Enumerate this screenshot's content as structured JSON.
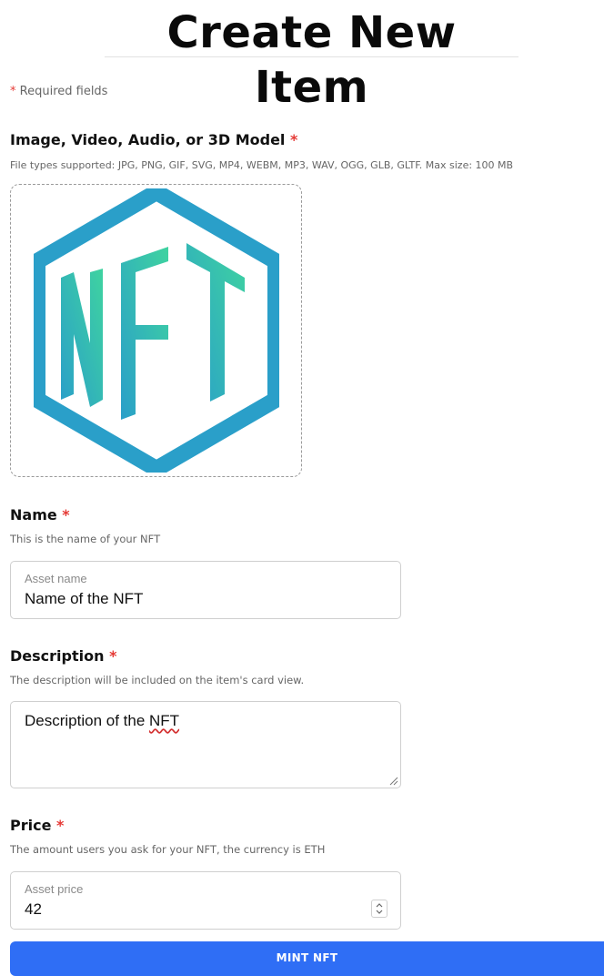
{
  "page": {
    "title": "Create New Item",
    "required_star": "*",
    "required_note": "Required fields"
  },
  "media": {
    "label": "Image, Video, Audio, or 3D Model",
    "hint": "File types supported: JPG, PNG, GIF, SVG, MP4, WEBM, MP3, WAV, OGG, GLB, GLTF. Max size: 100 MB",
    "preview_logo_text": "NFT"
  },
  "name_field": {
    "label": "Name",
    "hint": "This is the name of your NFT",
    "input_label": "Asset name",
    "value": "Name of the NFT"
  },
  "description_field": {
    "label": "Description",
    "hint": "The description will be included on the item's card view.",
    "value_prefix": "Description of the ",
    "value_misspelled": "NFT"
  },
  "price_field": {
    "label": "Price",
    "hint": "The amount users you ask for your NFT, the currency is ETH",
    "input_label": "Asset price",
    "value": "42"
  },
  "submit": {
    "label": "MINT NFT"
  },
  "colors": {
    "accent": "#2f6ef5",
    "required": "#e53935",
    "logo_blue": "#2a9fc9",
    "logo_green": "#3fd3a0"
  },
  "icons": {
    "resize_handle": "resize-grip-icon",
    "stepper": "up-down-chevron-icon"
  }
}
